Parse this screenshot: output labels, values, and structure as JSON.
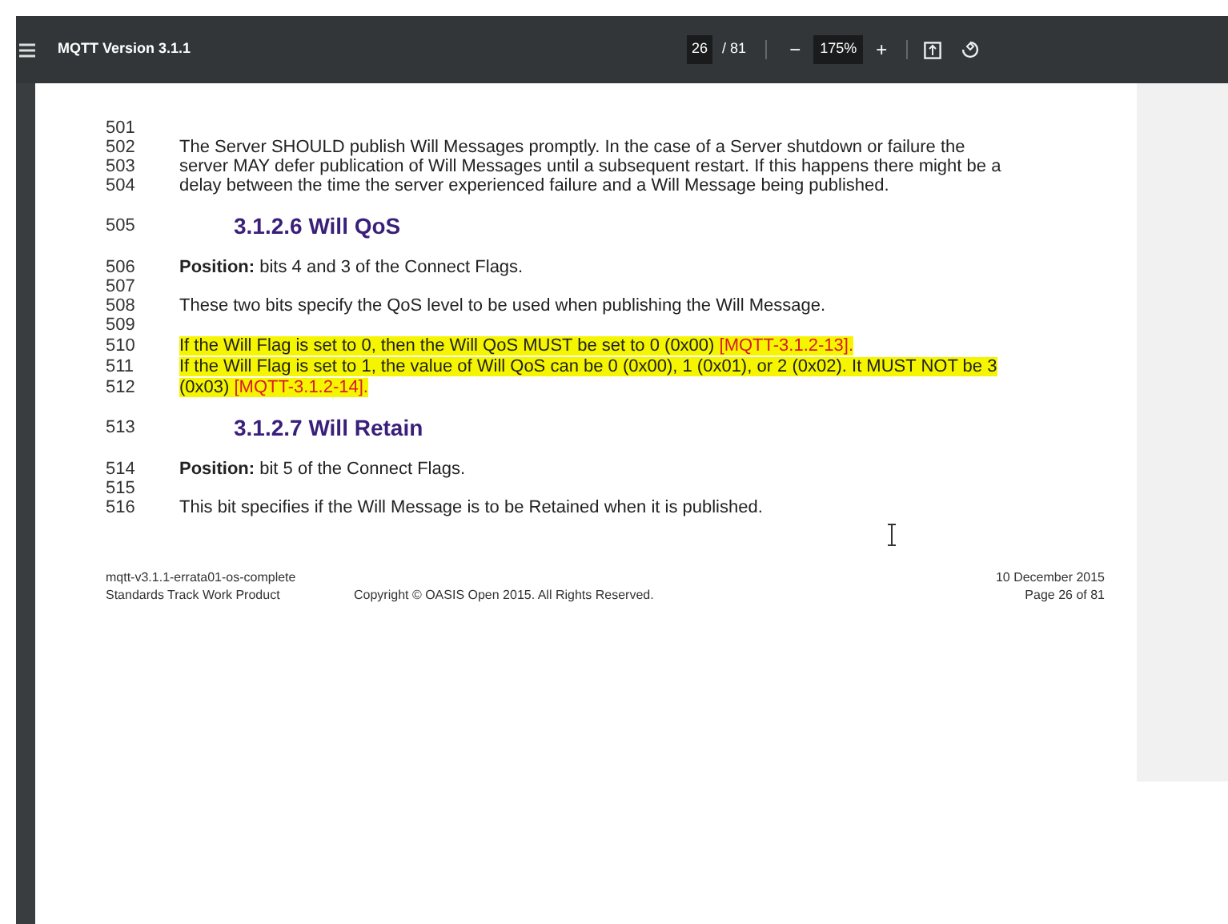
{
  "toolbar": {
    "title": "MQTT Version 3.1.1",
    "page_current": "26",
    "page_total": "/ 81",
    "zoom_out": "−",
    "zoom": "175%",
    "zoom_in": "+"
  },
  "lines": [
    {
      "number": "501",
      "kind": "blank"
    },
    {
      "number": "502",
      "kind": "text",
      "text": "The Server SHOULD publish Will Messages promptly. In the case of a Server shutdown or failure the"
    },
    {
      "number": "503",
      "kind": "text",
      "text": "server MAY defer publication of Will Messages until a subsequent restart. If this happens there might be a"
    },
    {
      "number": "504",
      "kind": "text",
      "text": "delay between the time the server experienced failure and a Will Message being published."
    },
    {
      "number": "505",
      "kind": "heading",
      "text": "3.1.2.6 Will QoS"
    },
    {
      "number": "506",
      "kind": "text",
      "text": "**Position:** bits 4 and 3 of the Connect Flags."
    },
    {
      "number": "507",
      "kind": "blank"
    },
    {
      "number": "508",
      "kind": "text",
      "text": "These two bits specify the QoS level to be used when publishing the Will Message."
    },
    {
      "number": "509",
      "kind": "blank"
    },
    {
      "number": "510",
      "kind": "highlight",
      "text": "If the Will Flag is set to 0, then the Will QoS MUST be set to 0 (0x00)",
      "ref": "[MQTT-3.1.2-13]."
    },
    {
      "number": "511",
      "kind": "highlight",
      "text": "If the Will Flag is set to 1, the value of Will QoS can be 0 (0x00), 1 (0x01), or 2 (0x02). It MUST NOT be 3"
    },
    {
      "number": "512",
      "kind": "highlight",
      "text": "(0x03)",
      "ref": "[MQTT-3.1.2-14]."
    },
    {
      "number": "513",
      "kind": "heading",
      "text": "3.1.2.7 Will Retain"
    },
    {
      "number": "514",
      "kind": "text",
      "text": "**Position:** bit 5 of the Connect Flags."
    },
    {
      "number": "515",
      "kind": "blank"
    },
    {
      "number": "516",
      "kind": "text",
      "text": "This bit specifies if the Will Message is to be Retained when it is published."
    }
  ],
  "footer": {
    "left": [
      "mqtt-v3.1.1-errata01-os-complete",
      "Standards Track Work Product"
    ],
    "center": "Copyright © OASIS Open 2015. All Rights Reserved.",
    "right": [
      "10 December 2015",
      "Page 26 of 81"
    ]
  }
}
